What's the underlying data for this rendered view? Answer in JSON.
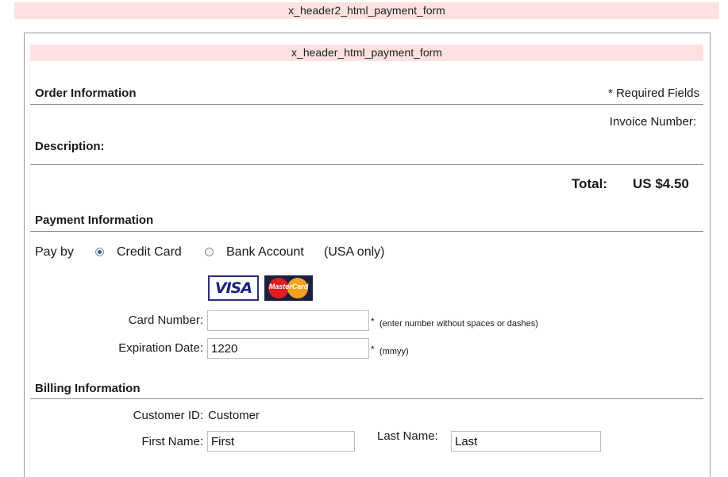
{
  "headers": {
    "outer": "x_header2_html_payment_form",
    "inner": "x_header_html_payment_form"
  },
  "order": {
    "title": "Order Information",
    "required_note": "* Required Fields",
    "invoice_label": "Invoice Number:",
    "description_label": "Description:",
    "total_label": "Total:",
    "total_value": "US $4.50"
  },
  "payment": {
    "title": "Payment Information",
    "pay_by_label": "Pay by",
    "option_credit": "Credit Card",
    "option_bank": "Bank Account",
    "bank_note": "(USA only)",
    "selected": "Credit Card",
    "visa_text": "VISA",
    "mastercard_text": "MasterCard",
    "card_number_label": "Card Number:",
    "card_number_value": "",
    "card_number_hint_star": "*",
    "card_number_hint": "(enter number without spaces or dashes)",
    "expiration_label": "Expiration Date:",
    "expiration_value": "1220",
    "expiration_hint_star": "*",
    "expiration_hint": "(mmyy)"
  },
  "billing": {
    "title": "Billing Information",
    "customer_id_label": "Customer ID:",
    "customer_id_value": "Customer",
    "first_name_label": "First Name:",
    "first_name_value": "First",
    "last_name_label": "Last Name:",
    "last_name_value": "Last"
  }
}
